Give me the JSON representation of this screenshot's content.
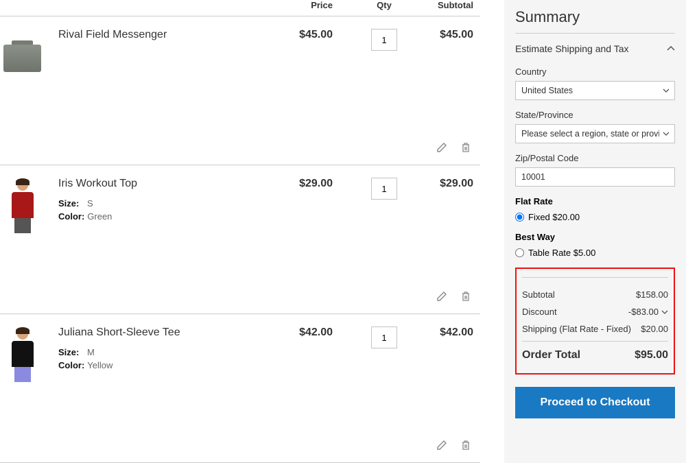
{
  "header": {
    "price": "Price",
    "qty": "Qty",
    "subtotal": "Subtotal"
  },
  "items": [
    {
      "name": "Rival Field Messenger",
      "price": "$45.00",
      "qty": "1",
      "subtotal": "$45.00",
      "image": "bag",
      "opts": []
    },
    {
      "name": "Iris Workout Top",
      "price": "$29.00",
      "qty": "1",
      "subtotal": "$29.00",
      "image": "red-person",
      "opts": [
        {
          "label": "Size:",
          "value": "S"
        },
        {
          "label": "Color:",
          "value": "Green"
        }
      ]
    },
    {
      "name": "Juliana Short-Sleeve Tee",
      "price": "$42.00",
      "qty": "1",
      "subtotal": "$42.00",
      "image": "black-person",
      "opts": [
        {
          "label": "Size:",
          "value": "M"
        },
        {
          "label": "Color:",
          "value": "Yellow"
        }
      ]
    }
  ],
  "summary": {
    "title": "Summary",
    "estimate_label": "Estimate Shipping and Tax",
    "country_label": "Country",
    "country": "United States",
    "state_label": "State/Province",
    "state_placeholder": "Please select a region, state or province.",
    "zip_label": "Zip/Postal Code",
    "zip": "10001",
    "methods": [
      {
        "title": "Flat Rate",
        "option": "Fixed $20.00",
        "selected": true
      },
      {
        "title": "Best Way",
        "option": "Table Rate $5.00",
        "selected": false
      }
    ],
    "totals": {
      "subtotal_label": "Subtotal",
      "subtotal": "$158.00",
      "discount_label": "Discount",
      "discount": "-$83.00",
      "shipping_label": "Shipping (Flat Rate - Fixed)",
      "shipping": "$20.00",
      "order_total_label": "Order Total",
      "order_total": "$95.00"
    },
    "checkout_label": "Proceed to Checkout"
  }
}
